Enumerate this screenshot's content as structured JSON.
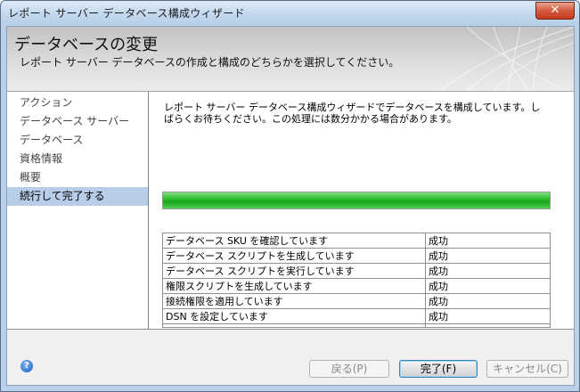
{
  "window": {
    "title": "レポート サーバー データベース構成ウィザード",
    "close_glyph": "✕"
  },
  "banner": {
    "title": "データベースの変更",
    "subtitle": "レポート サーバー データベースの作成と構成のどちらかを選択してください。"
  },
  "nav": {
    "items": [
      {
        "label": "アクション"
      },
      {
        "label": "データベース サーバー"
      },
      {
        "label": "データベース"
      },
      {
        "label": "資格情報"
      },
      {
        "label": "概要"
      },
      {
        "label": "続行して完了する"
      }
    ],
    "active_index": 5
  },
  "content": {
    "description": "レポート サーバー データベース構成ウィザードでデータベースを構成しています。しばらくお待ちください。この処理には数分かかる場合があります。",
    "progress": 1.0,
    "tasks": [
      {
        "task": "データベース SKU を確認しています",
        "status": "成功"
      },
      {
        "task": "データベース スクリプトを生成しています",
        "status": "成功"
      },
      {
        "task": "データベース スクリプトを実行しています",
        "status": "成功"
      },
      {
        "task": "権限スクリプトを生成しています",
        "status": "成功"
      },
      {
        "task": "接続権限を適用しています",
        "status": "成功"
      },
      {
        "task": "DSN を設定しています",
        "status": "成功"
      }
    ]
  },
  "footer": {
    "help_glyph": "?",
    "back_label": "戻る(P)",
    "finish_label": "完了(F)",
    "cancel_label": "キャンセル(C)"
  },
  "colors": {
    "progress_green": "#22b422",
    "nav_selected": "#b7cde8",
    "close_red": "#c8462a"
  },
  "icons": [
    "close-icon",
    "help-icon"
  ]
}
